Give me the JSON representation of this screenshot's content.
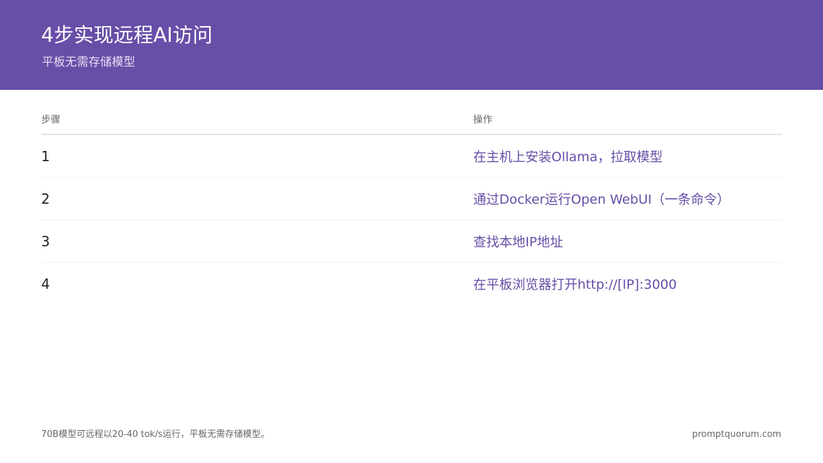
{
  "header": {
    "title": "4步实现远程AI访问",
    "subtitle": "平板无需存储模型"
  },
  "table": {
    "headers": [
      "步骤",
      "操作"
    ],
    "rows": [
      {
        "step": "1",
        "action": "在主机上安装Ollama，拉取模型"
      },
      {
        "step": "2",
        "action": "通过Docker运行Open WebUI（一条命令）"
      },
      {
        "step": "3",
        "action": "查找本地IP地址"
      },
      {
        "step": "4",
        "action": "在平板浏览器打开http://[IP]:3000"
      }
    ]
  },
  "footer": {
    "note": "70B模型可远程以20-40 tok/s运行，平板无需存储模型。",
    "source": "promptquorum.com"
  },
  "colors": {
    "accent": "#674ea7",
    "header_text": "#ffffff",
    "muted_text": "#666666"
  }
}
